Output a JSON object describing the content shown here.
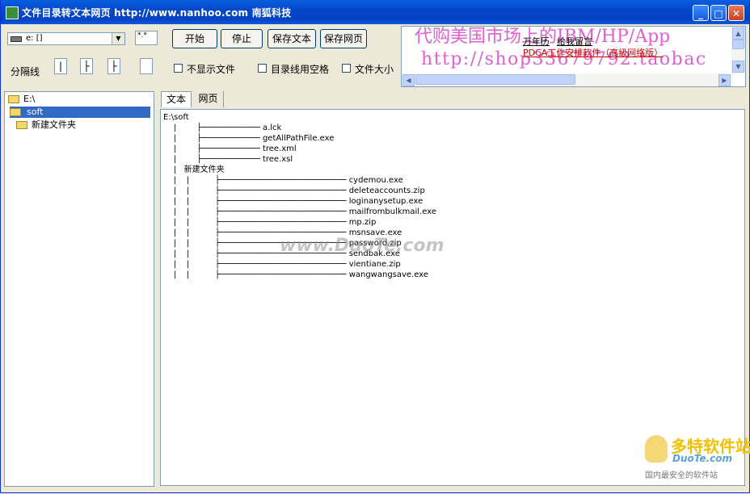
{
  "window": {
    "title": "文件目录转文本网页 http://www.nanhoo.com 南狐科技",
    "minimize": "_",
    "maximize": "□",
    "close": "✕"
  },
  "toolbar": {
    "drive_value": "e: []",
    "filter_value": "*.*",
    "buttons": [
      "开始",
      "停止",
      "保存文本",
      "保存网页"
    ],
    "separator_label": "分隔线",
    "separator_chars": [
      "|",
      "├",
      "├",
      ""
    ],
    "checkboxes": [
      "不显示文件",
      "目录线用空格",
      "文件大小"
    ]
  },
  "ad": {
    "line1": "代购美国市场上的IBM/HP/App",
    "line2": "http://shop33679792.taobac",
    "link1": "万年历",
    "link2": "给我留言",
    "link3": "PDCA工作安排软件（高级网络版）",
    "colors": {
      "big": "#e060d0",
      "link3": "#cc0000"
    }
  },
  "tree": {
    "items": [
      {
        "label": "E:\\",
        "icon": "open-folder-icon",
        "selected": false
      },
      {
        "label": "soft",
        "icon": "open-folder-icon",
        "selected": true
      },
      {
        "label": "新建文件夹",
        "icon": "folder-icon",
        "selected": false
      }
    ]
  },
  "tabs": [
    "文本",
    "网页"
  ],
  "text_output": {
    "lines": [
      "E:\\soft",
      "    |        ├──────────── a.lck",
      "    |        ├──────────── getAllPathFile.exe",
      "    |        ├──────────── tree.xml",
      "    |        ├──────────── tree.xsl",
      "    |   新建文件夹",
      "    |    |          ├────────────────────────── cydemou.exe",
      "    |    |          ├────────────────────────── deleteaccounts.zip",
      "    |    |          ├────────────────────────── loginanysetup.exe",
      "    |    |          ├────────────────────────── mailfrombulkmail.exe",
      "    |    |          ├────────────────────────── mp.zip",
      "    |    |          ├────────────────────────── msnsave.exe",
      "    |    |          ├────────────────────────── password.zip",
      "    |    |          ├────────────────────────── sendbak.exe",
      "    |    |          ├────────────────────────── vientiane.zip",
      "    |    |          ├────────────────────────── wangwangsave.exe"
    ]
  },
  "watermark": {
    "center": "www.DuoTe.com",
    "logo_main": "多特软件站",
    "logo_url": "DuoTe.com",
    "logo_tagline": "国内最安全的软件站"
  }
}
